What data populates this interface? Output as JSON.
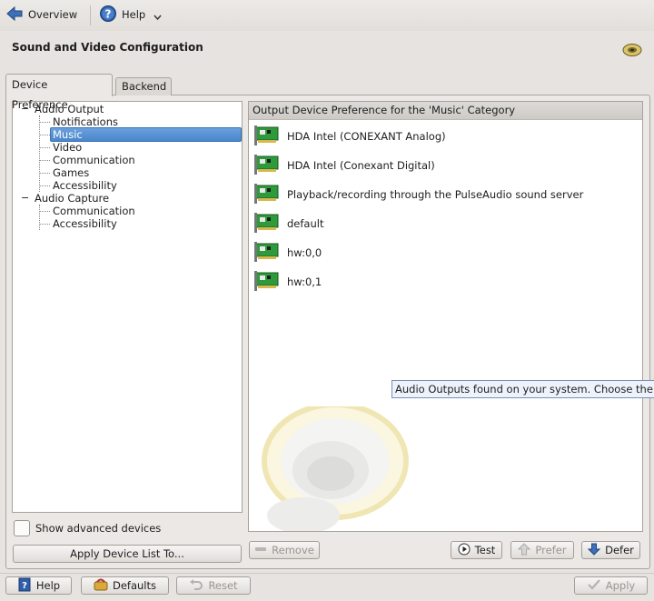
{
  "toolbar": {
    "overview_label": "Overview",
    "help_label": "Help"
  },
  "page": {
    "title": "Sound and Video Configuration"
  },
  "tabs": [
    {
      "label": "Device Preference",
      "active": true
    },
    {
      "label": "Backend",
      "active": false
    }
  ],
  "tree": {
    "groups": [
      {
        "label": "Audio Output",
        "toggle": "−",
        "children": [
          "Notifications",
          "Music",
          "Video",
          "Communication",
          "Games",
          "Accessibility"
        ]
      },
      {
        "label": "Audio Capture",
        "toggle": "−",
        "children": [
          "Communication",
          "Accessibility"
        ]
      }
    ],
    "selected": "Music"
  },
  "devices": {
    "header": "Output Device Preference for the 'Music' Category",
    "items": [
      "HDA Intel (CONEXANT Analog)",
      "HDA Intel (Conexant Digital)",
      "Playback/recording through the PulseAudio sound server",
      "default",
      "hw:0,0",
      "hw:0,1"
    ]
  },
  "tooltip": "Audio Outputs found on your system.  Choose the",
  "options": {
    "show_advanced_label": "Show advanced devices",
    "show_advanced_checked": false,
    "apply_list_label": "Apply Device List To..."
  },
  "device_actions": {
    "remove": "Remove",
    "test": "Test",
    "prefer": "Prefer",
    "defer": "Defer"
  },
  "footer": {
    "help": "Help",
    "defaults": "Defaults",
    "reset": "Reset",
    "apply": "Apply"
  },
  "colors": {
    "selection": "#4a86cc",
    "card_green": "#2f9a3c",
    "window_bg": "#e6e3e0"
  }
}
